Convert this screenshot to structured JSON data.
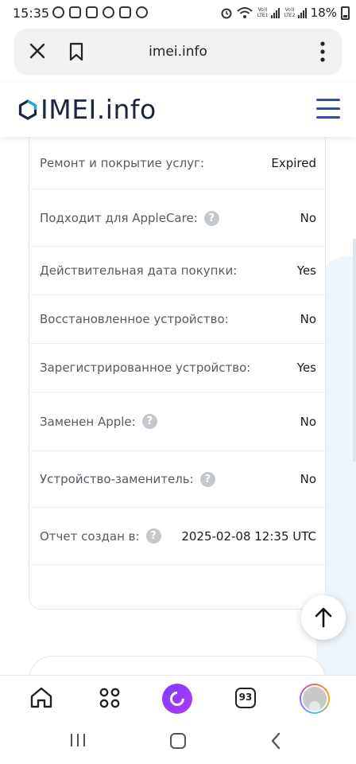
{
  "status_bar": {
    "time": "15:35",
    "battery": "18%",
    "sim1_label": "Vo)) LTE1",
    "sim2_label": "Vo)) LTE2"
  },
  "browser": {
    "url": "imei.info",
    "tabs_count": "93"
  },
  "site": {
    "logo_text": "IMEI.info",
    "brand_color": "#2e4fa0",
    "logo_accent": "#1ea8e0"
  },
  "info_rows": [
    {
      "label": "Ремонт и покрытие услуг:",
      "value": "Expired",
      "help": false
    },
    {
      "label": "Подходит для AppleCare:",
      "value": "No",
      "help": true
    },
    {
      "label": "Действительная дата покупки:",
      "value": "Yes",
      "help": false
    },
    {
      "label": "Восстановленное устройство:",
      "value": "No",
      "help": false
    },
    {
      "label": "Зарегистрированное устройство:",
      "value": "Yes",
      "help": false
    },
    {
      "label": "Заменен Apple:",
      "value": "No",
      "help": true
    },
    {
      "label": "Устройство-заменитель:",
      "value": "No",
      "help": true
    },
    {
      "label": "Отчет создан в:",
      "value": "2025-02-08 12:35 UTC",
      "help": true
    }
  ],
  "icons": {
    "help": "?",
    "scroll_top": "arrow-up-icon"
  }
}
